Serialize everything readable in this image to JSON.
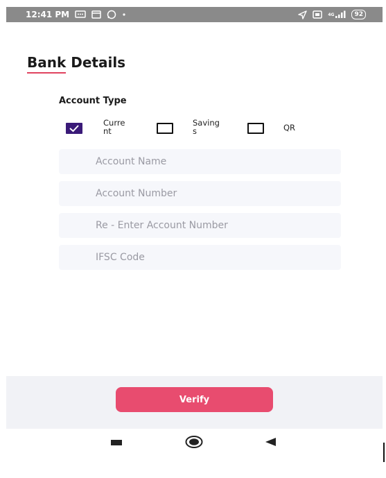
{
  "status_bar": {
    "time": "12:41 PM",
    "network": "4G",
    "battery": "92"
  },
  "page": {
    "title": "Bank Details"
  },
  "account_type": {
    "label": "Account Type",
    "options": [
      {
        "label_line1": "Curre",
        "label_line2": "nt",
        "checked": true
      },
      {
        "label_line1": "Saving",
        "label_line2": "s",
        "checked": false
      },
      {
        "label_line1": "QR",
        "label_line2": "",
        "checked": false
      }
    ]
  },
  "form": {
    "account_name_placeholder": "Account Name",
    "account_number_placeholder": "Account Number",
    "reenter_account_number_placeholder": "Re - Enter Account Number",
    "ifsc_placeholder": "IFSC Code"
  },
  "actions": {
    "verify_label": "Verify"
  },
  "colors": {
    "accent": "#e84c6f",
    "checkbox_checked": "#3a1a78",
    "field_bg": "#f6f7fb"
  }
}
